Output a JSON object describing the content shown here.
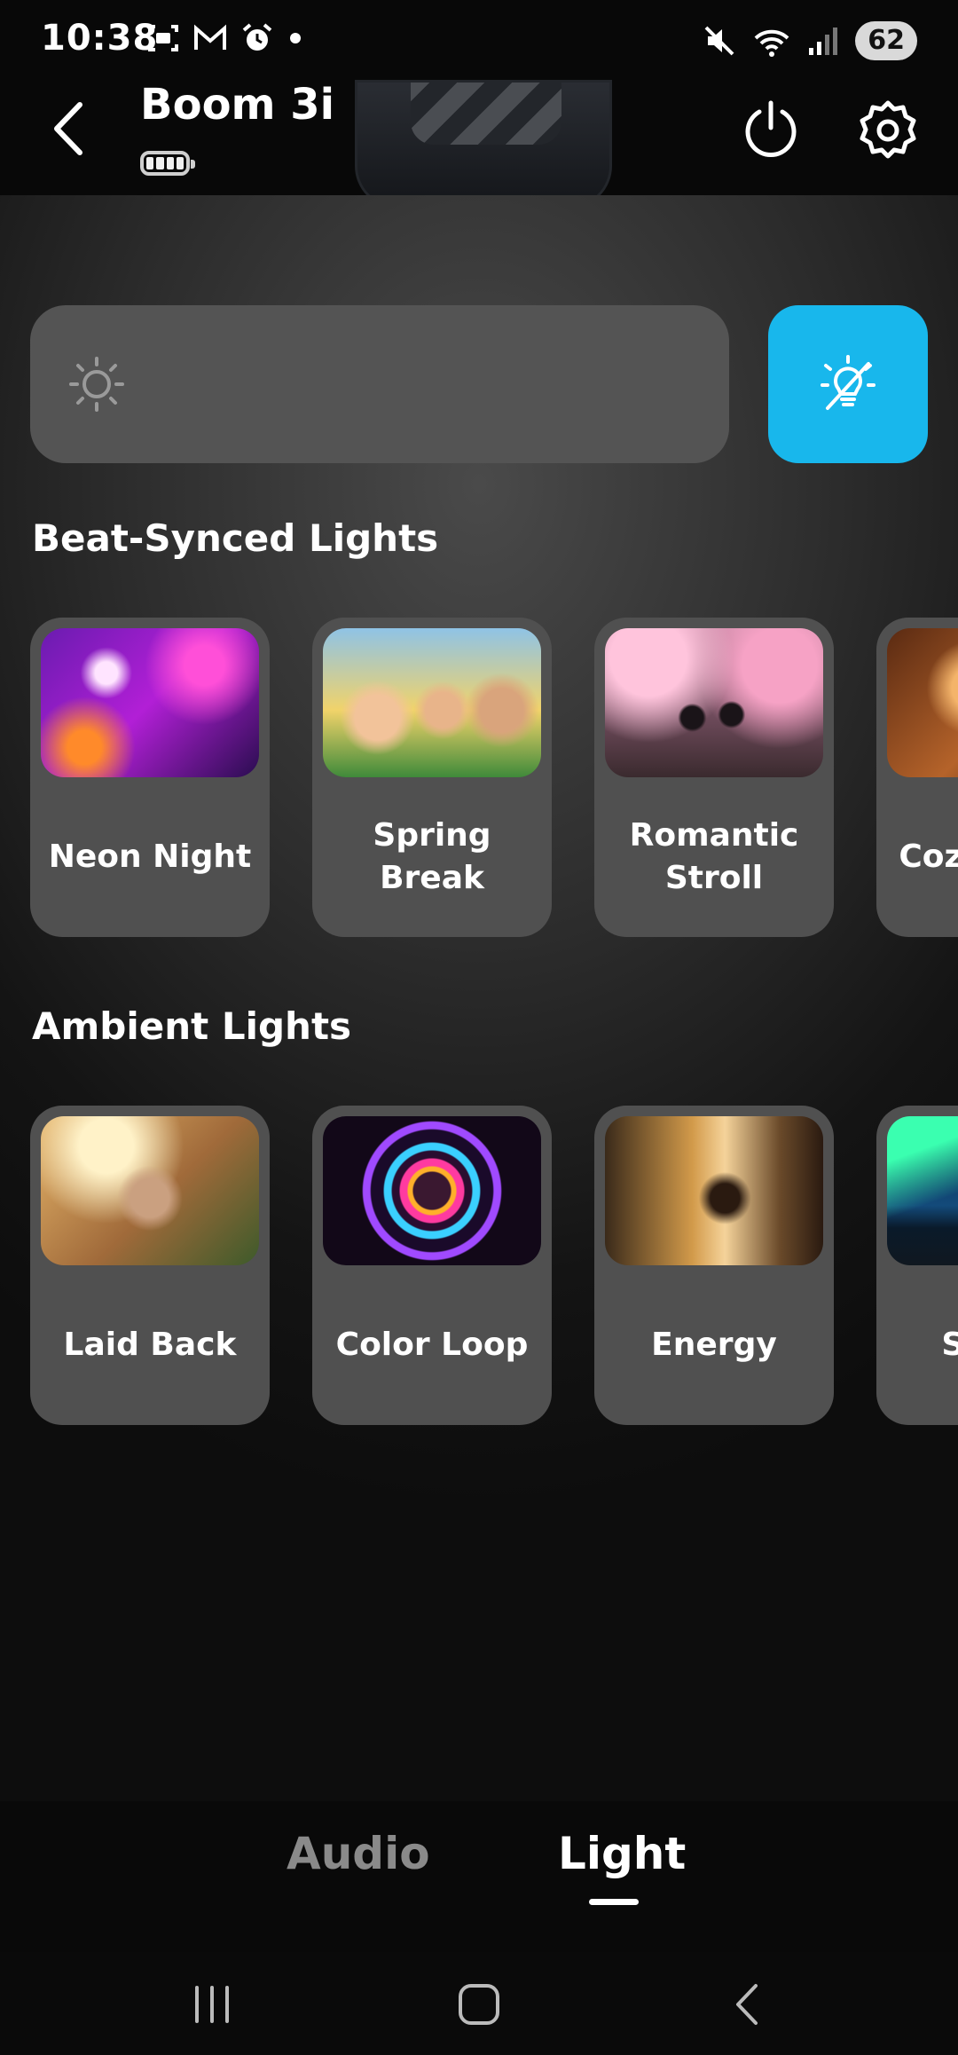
{
  "status_bar": {
    "time": "10:38",
    "battery_percent": "62",
    "left_icons": [
      "screenshot-icon",
      "gmail-icon",
      "alarm-icon",
      "notification-dot-icon"
    ],
    "right_icons": [
      "mute-icon",
      "wifi-icon",
      "signal-icon"
    ]
  },
  "header": {
    "title": "Boom 3i",
    "battery_level": 1.0,
    "icons": [
      "back-icon",
      "power-icon",
      "settings-icon"
    ]
  },
  "controls": {
    "brightness_icon": "sun-icon",
    "light_toggle_icon": "light-off-icon",
    "light_toggle_color": "#18b7ec"
  },
  "sections": {
    "beat_synced": {
      "title": "Beat-Synced Lights",
      "cards": [
        {
          "label": "Neon Night"
        },
        {
          "label": "Spring Break"
        },
        {
          "label": "Romantic Stroll"
        },
        {
          "label": "Cozy Vibes"
        }
      ]
    },
    "ambient": {
      "title": "Ambient Lights",
      "cards": [
        {
          "label": "Laid Back"
        },
        {
          "label": "Color Loop"
        },
        {
          "label": "Energy"
        },
        {
          "label": "Storm"
        }
      ]
    }
  },
  "tabs": {
    "audio": "Audio",
    "light": "Light",
    "active": "light"
  },
  "nav": [
    "recents-icon",
    "home-icon",
    "back-icon"
  ]
}
